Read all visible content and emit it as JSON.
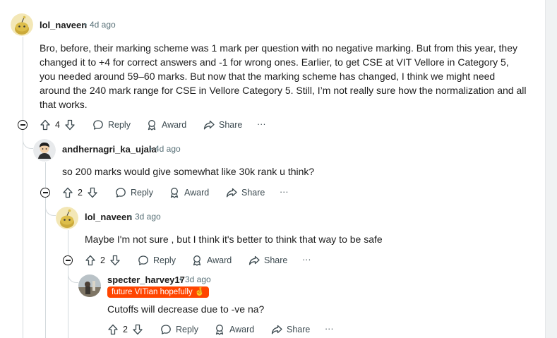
{
  "comments": [
    {
      "username": "lol_naveen",
      "age": "4d ago",
      "text": "Bro, before, their marking scheme was 1 mark per question with no negative marking. But from this year, they changed it to +4 for correct answers and -1 for wrong ones. Earlier, to get CSE at VIT Vellore in Category 5, you needed around 59–60 marks. But now that the marking scheme has changed, I think we might need around the 240 mark range for CSE in Vellore Category 5. Still, I’m not really sure how the normalization and all that works.",
      "votes": "4",
      "reply_label": "Reply",
      "award_label": "Award",
      "share_label": "Share",
      "more_label": "···"
    },
    {
      "username": "andhernagri_ka_ujala",
      "age": "4d ago",
      "text": "so 200 marks would give somewhat like 30k rank u think?",
      "votes": "2",
      "reply_label": "Reply",
      "award_label": "Award",
      "share_label": "Share",
      "more_label": "···"
    },
    {
      "username": "lol_naveen",
      "age": "3d ago",
      "text": "Maybe I'm not sure , but I think it's better to think that way to be safe",
      "votes": "2",
      "reply_label": "Reply",
      "award_label": "Award",
      "share_label": "Share",
      "more_label": "···"
    },
    {
      "username": "specter_harvey17",
      "age": "3d ago",
      "flair": "future VITian hopefully 🤞",
      "text": "Cutoffs will decrease due to -ve na?",
      "votes": "2",
      "reply_label": "Reply",
      "award_label": "Award",
      "share_label": "Share",
      "more_label": "···"
    }
  ],
  "separator": "•",
  "colors": {
    "flair_bg": "#ff4500",
    "thread_line": "#d3d9dc",
    "meta": "#576f76",
    "snoo_yellow": "#ccaa3a"
  },
  "icons": [
    "collapse-icon",
    "upvote-icon",
    "downvote-icon",
    "reply-icon",
    "award-icon",
    "share-icon",
    "more-icon",
    "snoo-avatar-icon"
  ]
}
